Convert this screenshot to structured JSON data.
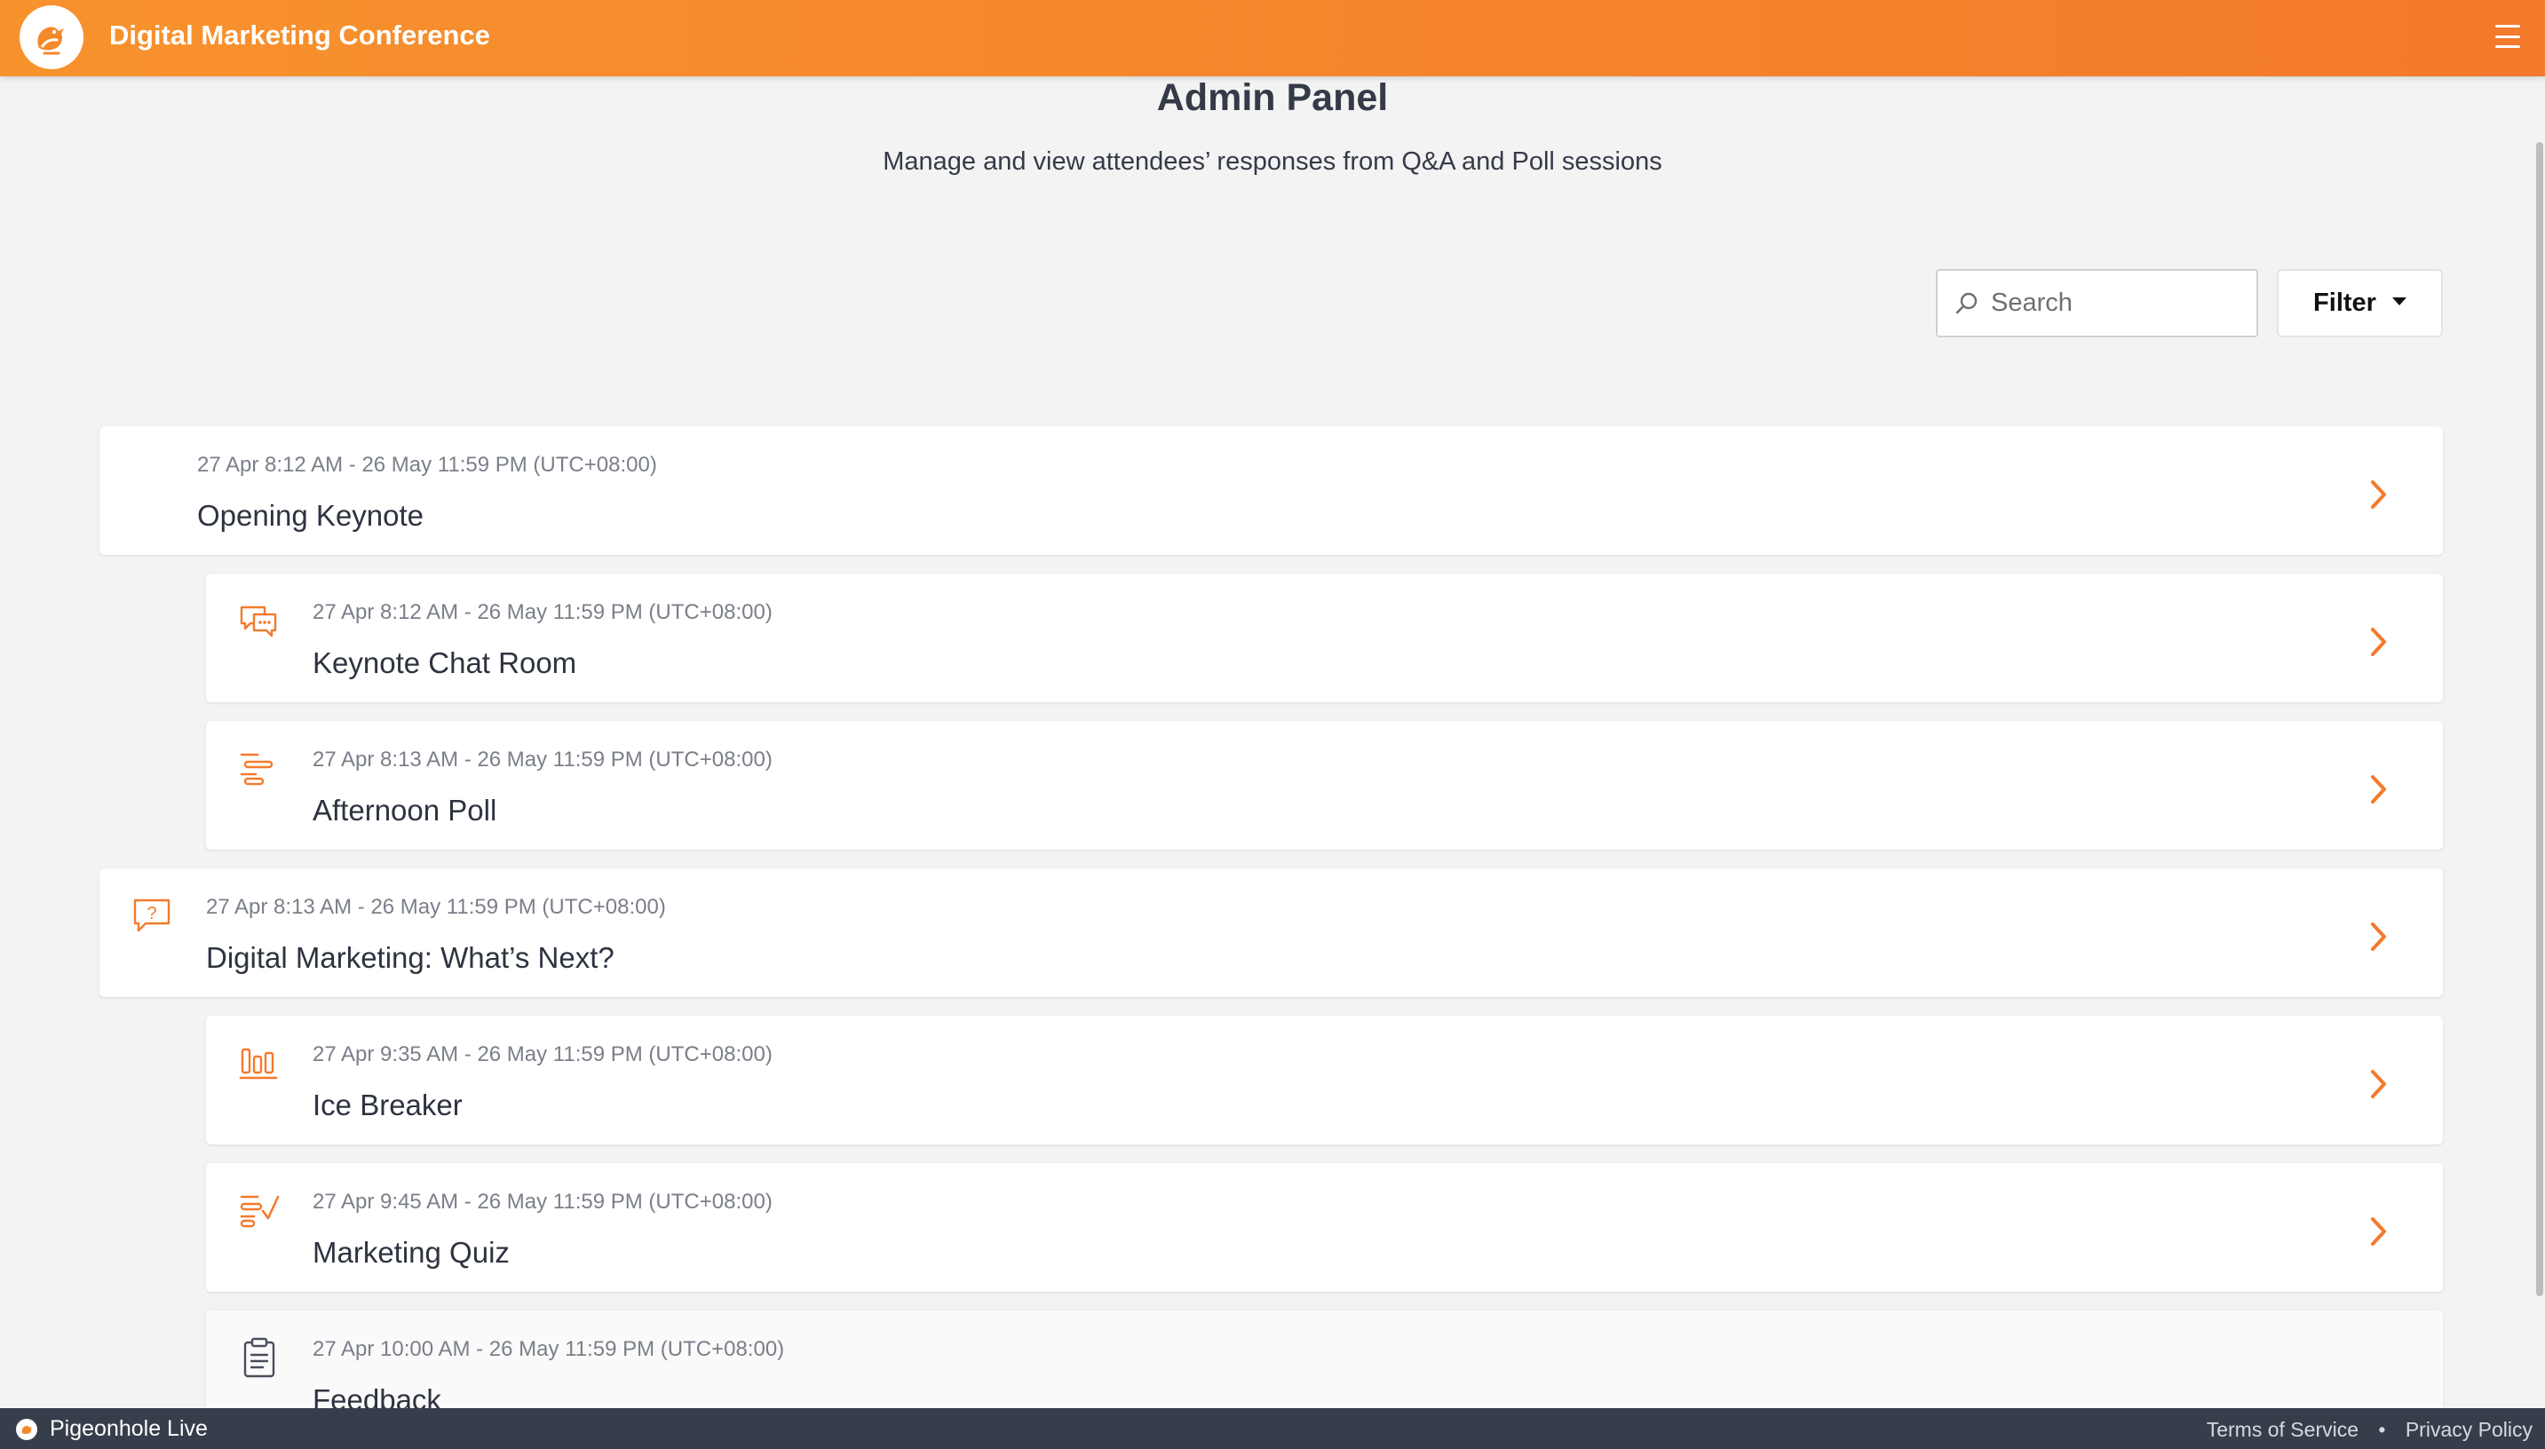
{
  "header": {
    "title": "Digital Marketing Conference",
    "logo_icon": "pigeon-logo-icon",
    "menu_icon": "hamburger-menu-icon"
  },
  "page": {
    "title": "Admin Panel",
    "subtitle": "Manage and view attendees’ responses from Q&A and Poll sessions"
  },
  "toolbar": {
    "search_placeholder": "Search",
    "filter_label": "Filter"
  },
  "sessions": [
    {
      "date": "27 Apr 8:12 AM - 26 May 11:59 PM (UTC+08:00)",
      "name": "Opening Keynote",
      "icon": "none",
      "level": 0
    },
    {
      "date": "27 Apr 8:12 AM - 26 May 11:59 PM (UTC+08:00)",
      "name": "Keynote Chat Room",
      "icon": "chat-icon",
      "level": 1
    },
    {
      "date": "27 Apr 8:13 AM - 26 May 11:59 PM (UTC+08:00)",
      "name": "Afternoon Poll",
      "icon": "poll-icon",
      "level": 1
    },
    {
      "date": "27 Apr 8:13 AM - 26 May 11:59 PM (UTC+08:00)",
      "name": "Digital Marketing: What’s Next?",
      "icon": "question-icon",
      "level": 0
    },
    {
      "date": "27 Apr 9:35 AM - 26 May 11:59 PM (UTC+08:00)",
      "name": "Ice Breaker",
      "icon": "bar-chart-icon",
      "level": 1
    },
    {
      "date": "27 Apr 9:45 AM - 26 May 11:59 PM (UTC+08:00)",
      "name": "Marketing Quiz",
      "icon": "quiz-icon",
      "level": 1
    },
    {
      "date": "27 Apr 10:00 AM - 26 May 11:59 PM (UTC+08:00)",
      "name": "Feedback",
      "icon": "clipboard-icon",
      "level": 1
    }
  ],
  "footer": {
    "brand": "Pigeonhole Live",
    "terms": "Terms of Service",
    "separator": "•",
    "privacy": "Privacy Policy"
  },
  "colors": {
    "accent": "#f47a2c",
    "header_start": "#f7922d",
    "footer_bg": "#373e4b",
    "background": "#f3f3f3"
  }
}
